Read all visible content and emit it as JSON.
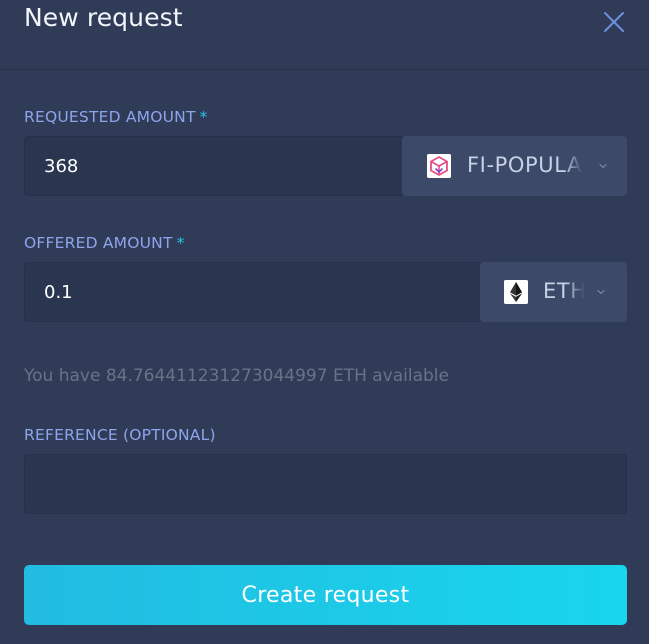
{
  "modal": {
    "title": "New request",
    "close_icon": "close-icon"
  },
  "requested": {
    "label": "REQUESTED AMOUNT",
    "required_mark": "*",
    "value": "368",
    "token": {
      "name": "FI-POPULA",
      "icon": "fi-popular-token-icon"
    }
  },
  "offered": {
    "label": "OFFERED AMOUNT",
    "required_mark": "*",
    "value": "0.1",
    "token": {
      "name": "ETH",
      "icon": "eth-token-icon"
    }
  },
  "available_text": "You have 84.764411231273044997 ETH available",
  "reference": {
    "label": "REFERENCE (OPTIONAL)",
    "value": ""
  },
  "submit_label": "Create request",
  "colors": {
    "background": "#2f3b57",
    "accent": "#1fc8e8",
    "label": "#8ea5ec",
    "required": "#27c4e8"
  }
}
